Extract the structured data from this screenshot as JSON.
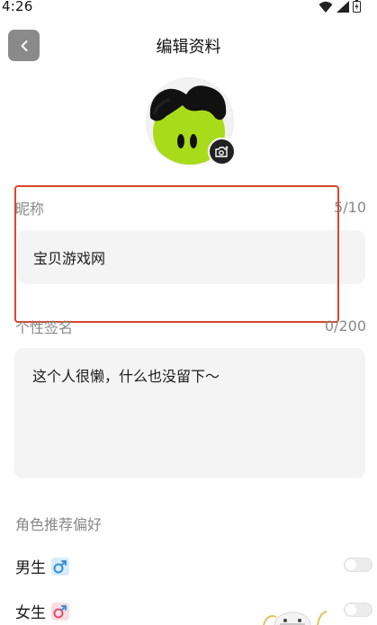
{
  "status_bar": {
    "time": "4:26"
  },
  "header": {
    "title": "编辑资料"
  },
  "nickname": {
    "label": "昵称",
    "count": "5/10",
    "value": "宝贝游戏网"
  },
  "signature": {
    "label": "个性签名",
    "count": "0/200",
    "value": "这个人很懒，什么也没留下～"
  },
  "preference": {
    "section_label": "角色推荐偏好",
    "options": [
      {
        "label": "男生",
        "icon": "male-symbol-icon",
        "enabled": false
      },
      {
        "label": "女生",
        "icon": "female-symbol-icon",
        "enabled": false
      }
    ]
  },
  "colors": {
    "highlight_border": "#d9452e",
    "input_background": "#f4f4f4",
    "back_button": "#8a8a8a",
    "male_icon": "#3a8fd8",
    "female_icon": "#e0506b",
    "avatar_green": "#a8dc1a"
  }
}
